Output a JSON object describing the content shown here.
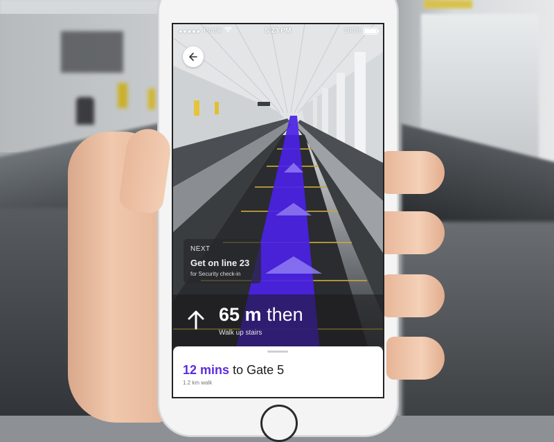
{
  "status_bar": {
    "carrier": "Pratik",
    "time": "5:23 PM",
    "battery": "100%"
  },
  "navigation": {
    "back_icon": "arrow-left-icon",
    "next_step": {
      "label": "NEXT",
      "title": "Get on line 23",
      "subtitle": "for Security check-in"
    },
    "current_step": {
      "icon": "arrow-up-icon",
      "distance_value": "65 m",
      "distance_suffix": "then",
      "instruction": "Walk up stairs"
    }
  },
  "eta_sheet": {
    "minutes": "12 mins",
    "destination": "to Gate 5",
    "walk_distance": "1.2 km walk"
  },
  "colors": {
    "accent": "#5b2be0",
    "ar_path": "#4a22e6",
    "card_bg": "#28282c"
  }
}
